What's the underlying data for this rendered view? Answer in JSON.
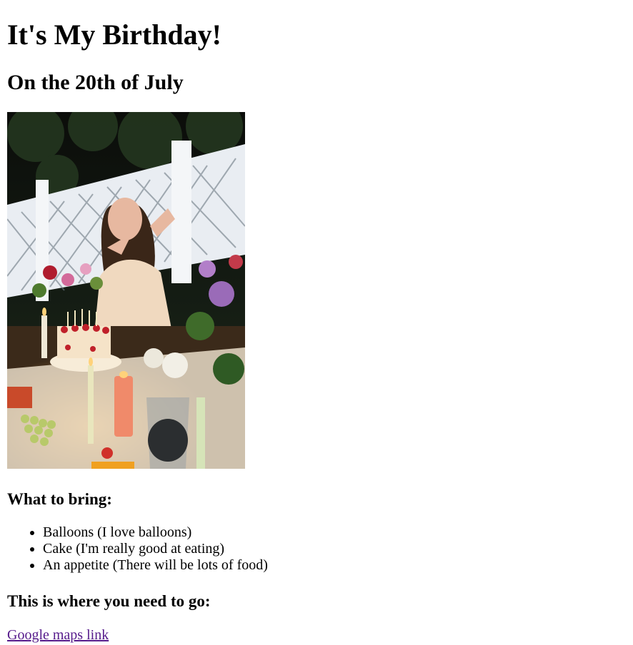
{
  "page": {
    "title": "It's My Birthday!",
    "subtitle": "On the 20th of July",
    "photo_alt": "birthday photo"
  },
  "bring": {
    "heading": "What to bring:",
    "items": [
      "Balloons (I love balloons)",
      "Cake (I'm really good at eating)",
      "An appetite (There will be lots of food)"
    ]
  },
  "location": {
    "heading": "This is where you need to go:",
    "link_label": "Google maps link"
  }
}
